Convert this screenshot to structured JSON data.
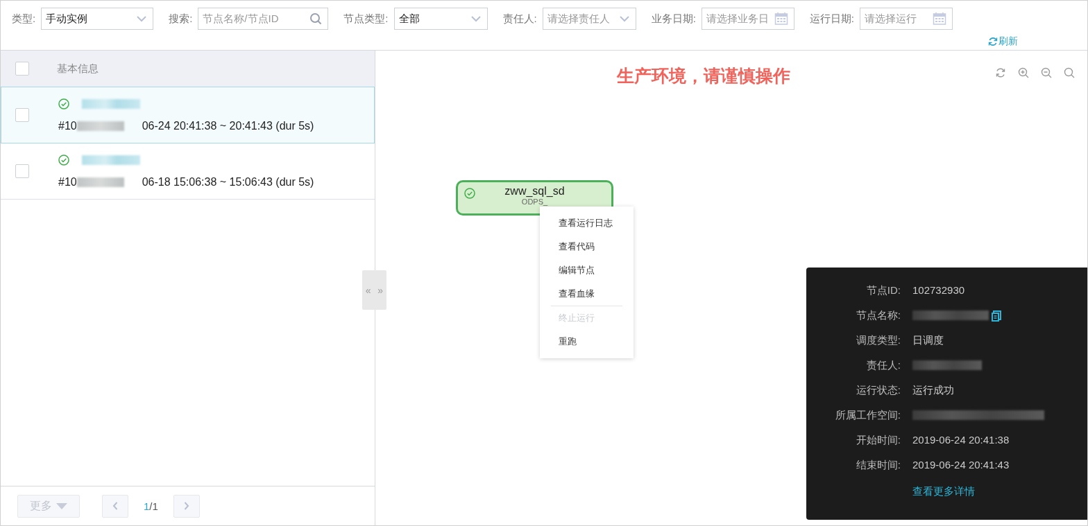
{
  "filters": [
    {
      "kind": "select",
      "label": "类型:",
      "value": "手动实例"
    },
    {
      "kind": "search",
      "label": "搜索:",
      "placeholder": "节点名称/节点ID"
    },
    {
      "kind": "select",
      "label": "节点类型:",
      "value": "全部"
    },
    {
      "kind": "select",
      "label": "责任人:",
      "placeholder": "请选择责任人"
    },
    {
      "kind": "date",
      "label": "业务日期:",
      "placeholder": "请选择业务日"
    },
    {
      "kind": "date",
      "label": "运行日期:",
      "placeholder": "请选择运行"
    }
  ],
  "refresh": "刷新",
  "list": {
    "header": "基本信息",
    "all_checked": false,
    "rows": [
      {
        "selected": true,
        "checked": false,
        "succeeded": true,
        "id_prefix": "#10",
        "time": "06-24 20:41:38 ~ 20:41:43 (dur 5s)"
      },
      {
        "selected": false,
        "checked": false,
        "succeeded": true,
        "id_prefix": "#10",
        "time": "06-18 15:06:38 ~ 15:06:43 (dur 5s)"
      }
    ]
  },
  "footer": {
    "more": "更多",
    "page_current": "1",
    "page_total": "/1"
  },
  "splitter": {
    "left": "«",
    "right": "»"
  },
  "canvas": {
    "warning": "生产环境，请谨慎操作",
    "node": {
      "name": "zww_sql_sd",
      "type": "ODPS_",
      "succeeded": true
    }
  },
  "context_menu": [
    {
      "kind": "item",
      "label": "查看运行日志",
      "disabled": false
    },
    {
      "kind": "item",
      "label": "查看代码",
      "disabled": false
    },
    {
      "kind": "item",
      "label": "编辑节点",
      "disabled": false
    },
    {
      "kind": "item",
      "label": "查看血缘",
      "disabled": false
    },
    {
      "kind": "divider"
    },
    {
      "kind": "item",
      "label": "终止运行",
      "disabled": true
    },
    {
      "kind": "item",
      "label": "重跑",
      "disabled": false
    }
  ],
  "info": {
    "rows": [
      {
        "kind": "text",
        "label": "节点ID:",
        "value": "102732930"
      },
      {
        "kind": "redacted",
        "label": "节点名称:",
        "copyable": true
      },
      {
        "kind": "text",
        "label": "调度类型:",
        "value": "日调度"
      },
      {
        "kind": "redacted",
        "label": "责任人:"
      },
      {
        "kind": "text",
        "label": "运行状态:",
        "value": "运行成功"
      },
      {
        "kind": "redacted",
        "label": "所属工作空间:"
      },
      {
        "kind": "text",
        "label": "开始时间:",
        "value": "2019-06-24 20:41:38"
      },
      {
        "kind": "text",
        "label": "结束时间:",
        "value": "2019-06-24 20:41:43"
      }
    ],
    "link": "查看更多详情"
  }
}
